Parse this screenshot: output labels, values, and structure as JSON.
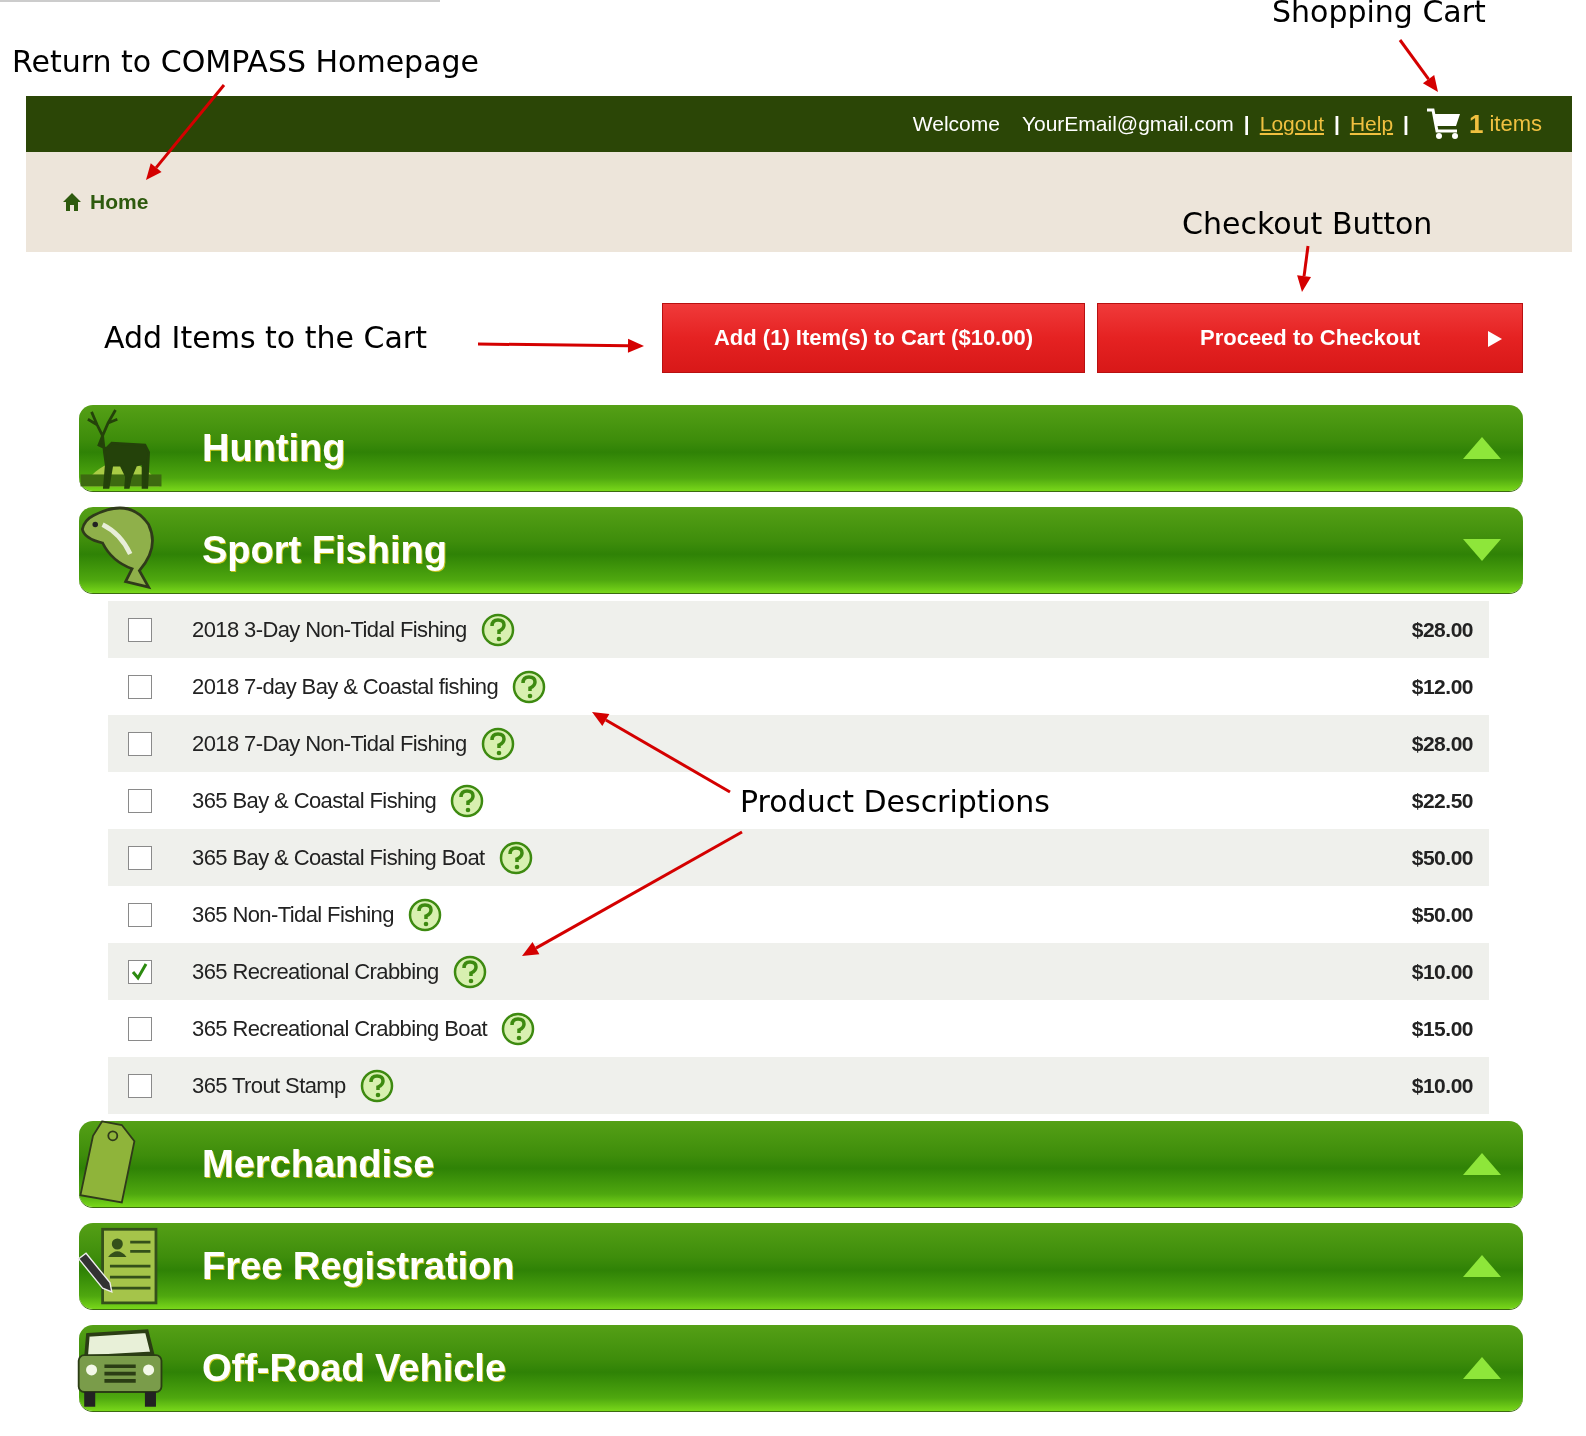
{
  "annotations": [
    {
      "text": "Return to COMPASS Homepage"
    },
    {
      "text": "Shopping Cart"
    },
    {
      "text": "Checkout Button"
    },
    {
      "text": "Add Items to the Cart"
    },
    {
      "text": "Product Descriptions"
    }
  ],
  "header": {
    "welcome": "Welcome",
    "email": "YourEmail@gmail.com",
    "links": [
      "Logout",
      "Help"
    ],
    "separators": [
      "|",
      "|",
      "|"
    ],
    "cart_count": "1",
    "cart_label": "items"
  },
  "breadcrumb": {
    "label": "Home"
  },
  "buttons": [
    {
      "label": "Add (1) Item(s) to Cart ($10.00)",
      "kind": "add"
    },
    {
      "label": "Proceed to Checkout",
      "kind": "checkout"
    }
  ],
  "categories": [
    {
      "title": "Hunting",
      "kind": "hunting",
      "expanded": false
    },
    {
      "title": "Sport Fishing",
      "kind": "fishing",
      "expanded": true,
      "items": [
        {
          "label": "2018 3-Day Non-Tidal Fishing",
          "price": "$28.00",
          "checked": false
        },
        {
          "label": "2018 7-day Bay & Coastal fishing",
          "price": "$12.00",
          "checked": false
        },
        {
          "label": "2018 7-Day Non-Tidal Fishing",
          "price": "$28.00",
          "checked": false
        },
        {
          "label": "365 Bay & Coastal Fishing",
          "price": "$22.50",
          "checked": false
        },
        {
          "label": "365 Bay & Coastal Fishing Boat",
          "price": "$50.00",
          "checked": false
        },
        {
          "label": "365 Non-Tidal Fishing",
          "price": "$50.00",
          "checked": false
        },
        {
          "label": "365 Recreational Crabbing",
          "price": "$10.00",
          "checked": true
        },
        {
          "label": "365 Recreational Crabbing Boat",
          "price": "$15.00",
          "checked": false
        },
        {
          "label": "365 Trout Stamp",
          "price": "$10.00",
          "checked": false
        }
      ]
    },
    {
      "title": "Merchandise",
      "kind": "merchandise",
      "expanded": false
    },
    {
      "title": "Free Registration",
      "kind": "registration",
      "expanded": false
    },
    {
      "title": "Off-Road Vehicle",
      "kind": "vehicle",
      "expanded": false
    }
  ]
}
